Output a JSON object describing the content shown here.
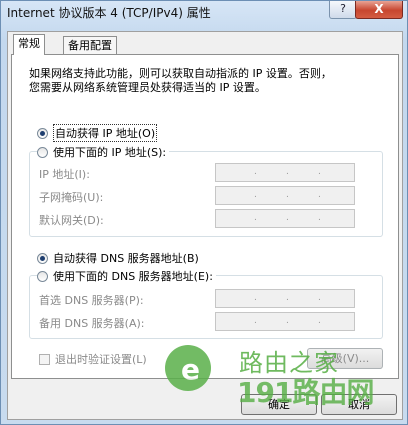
{
  "window": {
    "title": "Internet 协议版本 4 (TCP/IPv4) 属性",
    "help_label": "?",
    "close_label": "X"
  },
  "tabs": [
    {
      "label": "常规",
      "active": true
    },
    {
      "label": "备用配置",
      "active": false
    }
  ],
  "description": {
    "line1": "如果网络支持此功能，则可以获取自动指派的 IP 设置。否则，",
    "line2": "您需要从网络系统管理员处获得适当的 IP 设置。"
  },
  "ip": {
    "auto_label": "自动获得 IP 地址(O)",
    "manual_label": "使用下面的 IP 地址(S):",
    "selected": "auto",
    "fields": [
      {
        "label": "IP 地址(I):",
        "value": ". . ."
      },
      {
        "label": "子网掩码(U):",
        "value": ". . ."
      },
      {
        "label": "默认网关(D):",
        "value": ". . ."
      }
    ]
  },
  "dns": {
    "auto_label": "自动获得 DNS 服务器地址(B)",
    "manual_label": "使用下面的 DNS 服务器地址(E):",
    "selected": "auto",
    "fields": [
      {
        "label": "首选 DNS 服务器(P):",
        "value": ". . ."
      },
      {
        "label": "备用 DNS 服务器(A):",
        "value": ". . ."
      }
    ]
  },
  "validate_on_exit_label": "退出时验证设置(L)",
  "advanced_button_label": "高级(V)...",
  "ok_button_label": "确定",
  "cancel_button_label": "取消",
  "watermark": {
    "text_cn": "路由之家",
    "text_num": "191路由网"
  }
}
